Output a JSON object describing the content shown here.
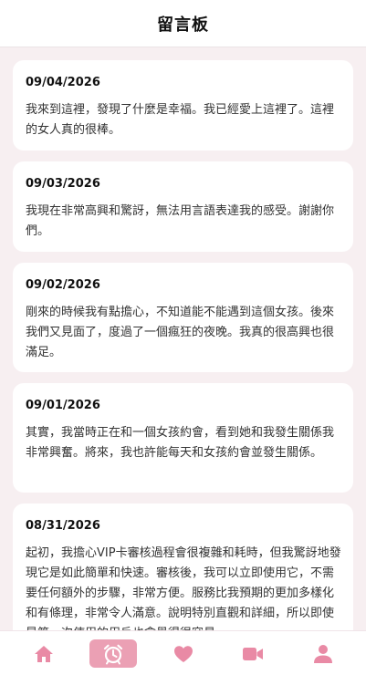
{
  "header": {
    "title": "留言板"
  },
  "messages": [
    {
      "date": "09/04/2026",
      "text": "我來到這裡，發現了什麼是幸福。我已經愛上這裡了。這裡的女人真的很棒。"
    },
    {
      "date": "09/03/2026",
      "text": "我現在非常高興和驚訝，無法用言語表達我的感受。謝謝你們。"
    },
    {
      "date": "09/02/2026",
      "text": "剛來的時候我有點擔心，不知道能不能遇到這個女孩。後來我們又見面了，度過了一個瘋狂的夜晚。我真的很高興也很滿足。"
    },
    {
      "date": "09/01/2026",
      "text": "其實，我當時正在和一個女孩約會，看到她和我發生關係我非常興奮。將來，我也許能每天和女孩約會並發生關係。"
    },
    {
      "date": "08/31/2026",
      "text": "起初，我擔心VIP卡審核過程會很複雜和耗時，但我驚訝地發現它是如此簡單和快速。審核後，我可以立即使用它，不需要任何額外的步驟，非常方便。服務比我預期的更加多樣化和有條理，非常令人滿意。說明特別直觀和詳細，所以即使是第一次使用的用戶也會覺得很容易。"
    }
  ],
  "tabbar": {
    "tabs": [
      {
        "icon": "home-icon"
      },
      {
        "icon": "alarm-clock-icon",
        "active": true
      },
      {
        "icon": "heart-icon"
      },
      {
        "icon": "video-camera-icon"
      },
      {
        "icon": "user-icon"
      }
    ]
  },
  "colors": {
    "accent": "#eba0b4",
    "icon": "#e98aa5",
    "background": "#f7eff1"
  }
}
